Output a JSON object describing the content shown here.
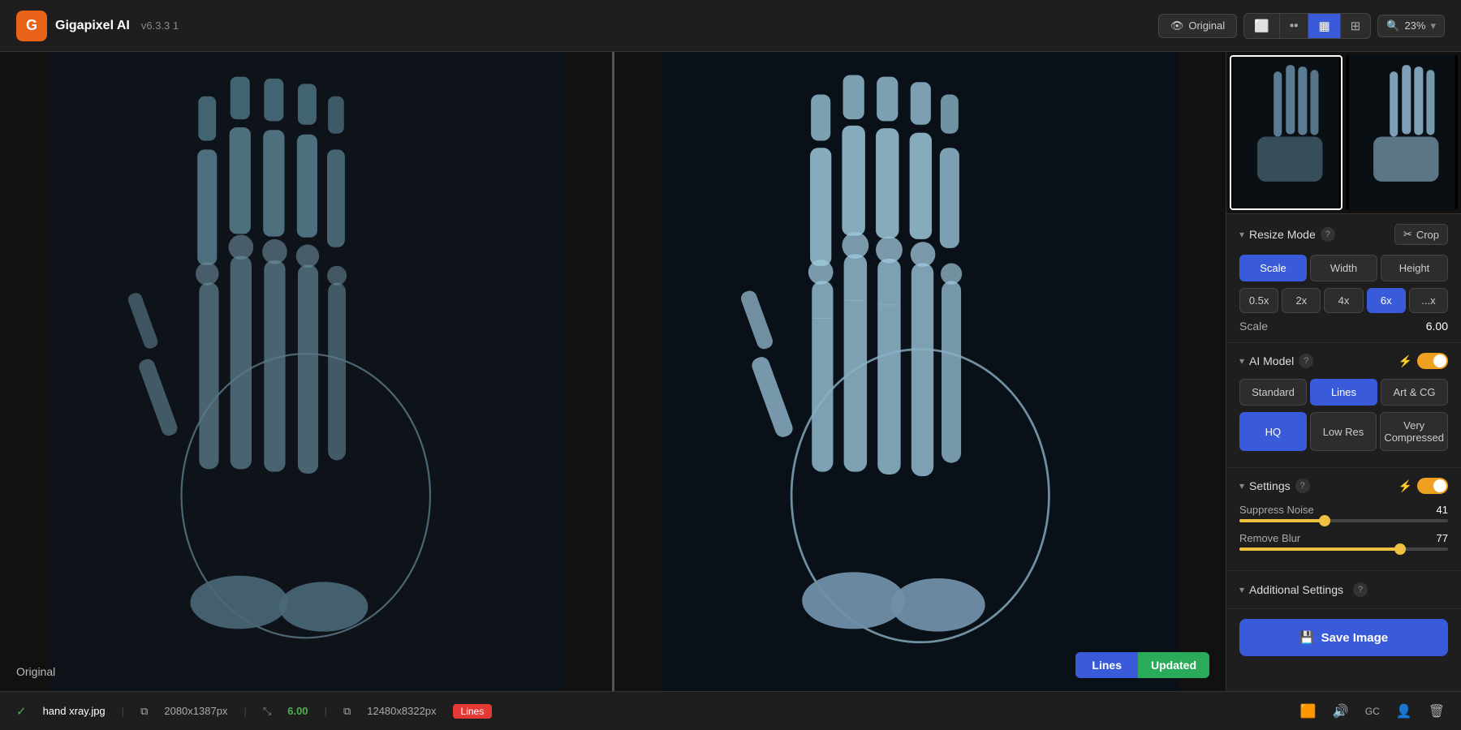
{
  "app": {
    "name": "Gigapixel AI",
    "version": "v6.3.3 1"
  },
  "topbar": {
    "original_btn": "Original",
    "zoom_level": "23%",
    "zoom_icon": "🔍"
  },
  "view_modes": [
    {
      "id": "single",
      "icon": "⬜",
      "active": false
    },
    {
      "id": "split",
      "icon": "⬜⬜",
      "active": false
    },
    {
      "id": "side-by-side",
      "icon": "▦",
      "active": true
    },
    {
      "id": "grid",
      "icon": "⊞",
      "active": false
    }
  ],
  "image_viewport": {
    "left_label": "Original",
    "model_badge": "Lines",
    "status_badge": "Updated"
  },
  "statusbar": {
    "filename": "hand xray.jpg",
    "original_dims": "2080x1387px",
    "scale": "6.00",
    "output_dims": "12480x8322px",
    "model": "Lines",
    "icons": [
      "🟧",
      "🔊",
      "GC",
      "👤",
      "🗑"
    ]
  },
  "right_panel": {
    "resize_mode": {
      "title": "Resize Mode",
      "crop_btn": "Crop",
      "tabs": [
        "Scale",
        "Width",
        "Height"
      ],
      "active_tab": "Scale",
      "scale_btns": [
        "0.5x",
        "2x",
        "4x",
        "6x",
        "...x"
      ],
      "active_scale": "6x",
      "scale_label": "Scale",
      "scale_value": "6.00"
    },
    "ai_model": {
      "title": "AI Model",
      "tabs": [
        "Standard",
        "Lines",
        "Art & CG"
      ],
      "active_tab": "Lines",
      "sub_tabs": [
        "HQ",
        "Low Res",
        "Very Compressed"
      ],
      "active_sub": "HQ",
      "toggle_on": true
    },
    "settings": {
      "title": "Settings",
      "toggle_on": true,
      "suppress_noise_label": "Suppress Noise",
      "suppress_noise_value": "41",
      "suppress_noise_pct": 41,
      "remove_blur_label": "Remove Blur",
      "remove_blur_value": "77",
      "remove_blur_pct": 77
    },
    "additional_settings": {
      "title": "Additional Settings"
    },
    "save_btn": "Save Image"
  }
}
